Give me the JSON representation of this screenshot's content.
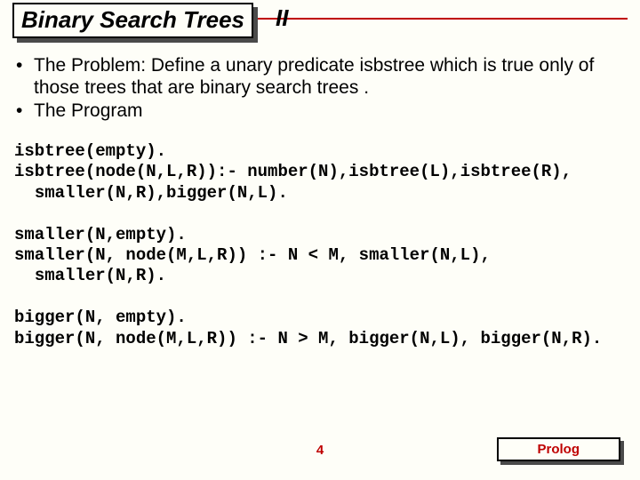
{
  "title": {
    "boxed": "Binary Search Trees",
    "suffix": "II"
  },
  "bullets": [
    "The Problem: Define a unary predicate isbstree which is true only of those trees that are binary search trees .",
    "The Program"
  ],
  "code": {
    "block1": "isbtree(empty).\nisbtree(node(N,L,R)):- number(N),isbtree(L),isbtree(R),\n  smaller(N,R),bigger(N,L).",
    "block2": "smaller(N,empty).\nsmaller(N, node(M,L,R)) :- N < M, smaller(N,L),\n  smaller(N,R).",
    "block3": "bigger(N, empty).\nbigger(N, node(M,L,R)) :- N > M, bigger(N,L), bigger(N,R)."
  },
  "footer": {
    "page": "4",
    "label": "Prolog"
  }
}
